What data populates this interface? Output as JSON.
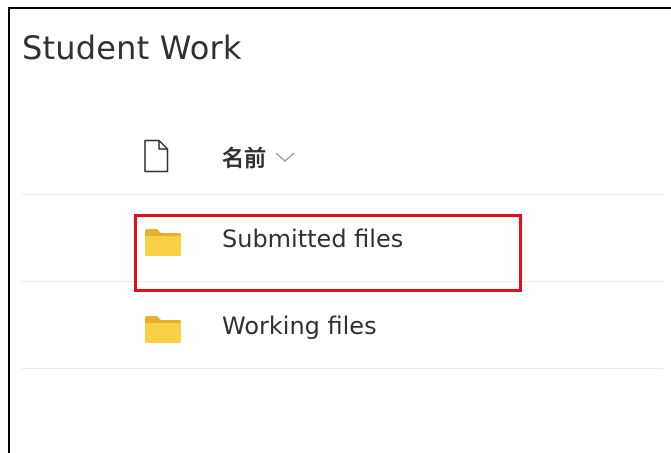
{
  "library": {
    "title": "Student Work"
  },
  "columns": {
    "name_label": "名前",
    "file_type_icon": "document-icon",
    "sort_icon": "chevron-down-icon"
  },
  "files": [
    {
      "name": "Submitted files",
      "type": "folder",
      "icon": "folder-icon"
    },
    {
      "name": "Working files",
      "type": "folder",
      "icon": "folder-icon"
    }
  ],
  "colors": {
    "folder": "#f8d046",
    "folder_tab": "#e8b02a",
    "highlight": "#e0101a",
    "text": "#323130",
    "divider": "#edebe9"
  }
}
